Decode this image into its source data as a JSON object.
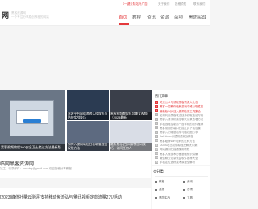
{
  "topbar": {
    "hot_link": "€一键去除站外广告",
    "links": [
      "关于我们",
      "投稿须知",
      "联系我们"
    ]
  },
  "header": {
    "logo": "网",
    "tagline_1": "黑客资源网",
    "tagline_2": "一个专注分享原创教程的网站",
    "nav": [
      "首页",
      "教程",
      "资讯",
      "资源",
      "杂项",
      "黑防实战"
    ]
  },
  "slider": {
    "caption": "黑客视频教程360安全卫士绕过方法最新版"
  },
  "thumbs": [
    {
      "caption": "黑客平台网络渗透入侵攻击与防护实战技巧"
    },
    {
      "caption": "黑客视频教程抖音美女视频（2023最新）"
    },
    {
      "caption": "如何入侵网站后台获取管理员权限方法"
    },
    {
      "caption": "最新版QQ空间解锁密码技巧，访问任何人"
    }
  ],
  "section": {
    "title": "临网黑客资源网",
    "sub": "站主，收录邮件：hmsdsq@gmail.com 欢迎投稿分享教程"
  },
  "post": {
    "title": "[2023]峰值社量云测评/支持移动免流弘与/腾讯视频定向流量2万/活动"
  },
  "rank": {
    "title": "热门文章",
    "items": [
      "关注公众号领取黑客资源大礼包",
      "黑客一招教你破解游戏中难以取胜的",
      "最新版SQL注入漏洞检测工具集合",
      "如何利用黑客攻击技术获取电话号码",
      "黑客入侵手机微信聊天记录查看方法",
      "手机远程控制另一台手机的软件推荐",
      "黑客常用的端口扫描工具下载合集",
      "黑客入门零基础学习路线图分享",
      "Kali Linux渗透测试实战教程",
      "黑客破解WiFi密码的五种方法",
      "DDoS攻击防御原理及解决方案",
      "网站漏洞扫描器使用教程",
      "黑客入侵技术必备基础知识讲解",
      "微信聊天记录恢复软件推荐大全",
      "手机定位追踪技术原理全解析"
    ]
  },
  "category": {
    "title": "分类",
    "cells": [
      {
        "label": "教程"
      },
      {
        "label": "资讯"
      },
      {
        "label": "资源"
      },
      {
        "label": "杂项"
      },
      {
        "label": "黑防实战"
      },
      {
        "label": "工具"
      }
    ]
  },
  "colors": {
    "accent": "#e4393c"
  }
}
